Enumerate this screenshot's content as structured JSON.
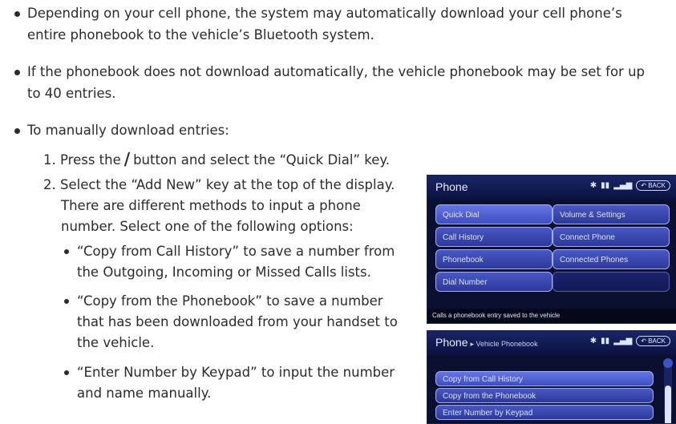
{
  "bullets": [
    {
      "line1": "Depending on your cell phone, the system may automatically download your cell phone’s",
      "line2": "entire phonebook to the vehicle’s Bluetooth system."
    },
    {
      "line1": "If the phonebook does not download automatically, the vehicle phonebook may be set for up",
      "line2": "to 40 entries."
    },
    {
      "line1": "To manually download entries:"
    }
  ],
  "steps": {
    "s1_a": "1. Press the",
    "s1_b": "button and select the “Quick Dial” key.",
    "s2_l1": "2. Select the “Add New” key at the top of the display.",
    "s2_l2": "There are different methods to input a phone",
    "s2_l3": "number. Select one of the following options:"
  },
  "options": [
    {
      "line1": "“Copy from Call History” to save a number from",
      "line2": "the Outgoing, Incoming or Missed Calls lists."
    },
    {
      "line1": "“Copy from the Phonebook” to save a number",
      "line2": "that has been downloaded from your handset to",
      "line3": "the vehicle."
    },
    {
      "line1": "“Enter Number by Keypad” to input the number",
      "line2": "and name manually."
    }
  ],
  "screen1": {
    "title": "Phone",
    "back": "BACK",
    "left_buttons": [
      "Quick Dial",
      "Call History",
      "Phonebook",
      "Dial Number"
    ],
    "right_buttons": [
      "Volume & Settings",
      "Connect Phone",
      "Connected Phones"
    ],
    "footer": "Calls a phonebook entry saved to the vehicle"
  },
  "screen2": {
    "title": "Phone",
    "subtitle": "▸ Vehicle Phonebook",
    "back": "BACK",
    "items": [
      "Copy from Call History",
      "Copy from the Phonebook",
      "Enter Number by Keypad"
    ]
  },
  "icons": {
    "phone": "phone-handset-icon"
  }
}
